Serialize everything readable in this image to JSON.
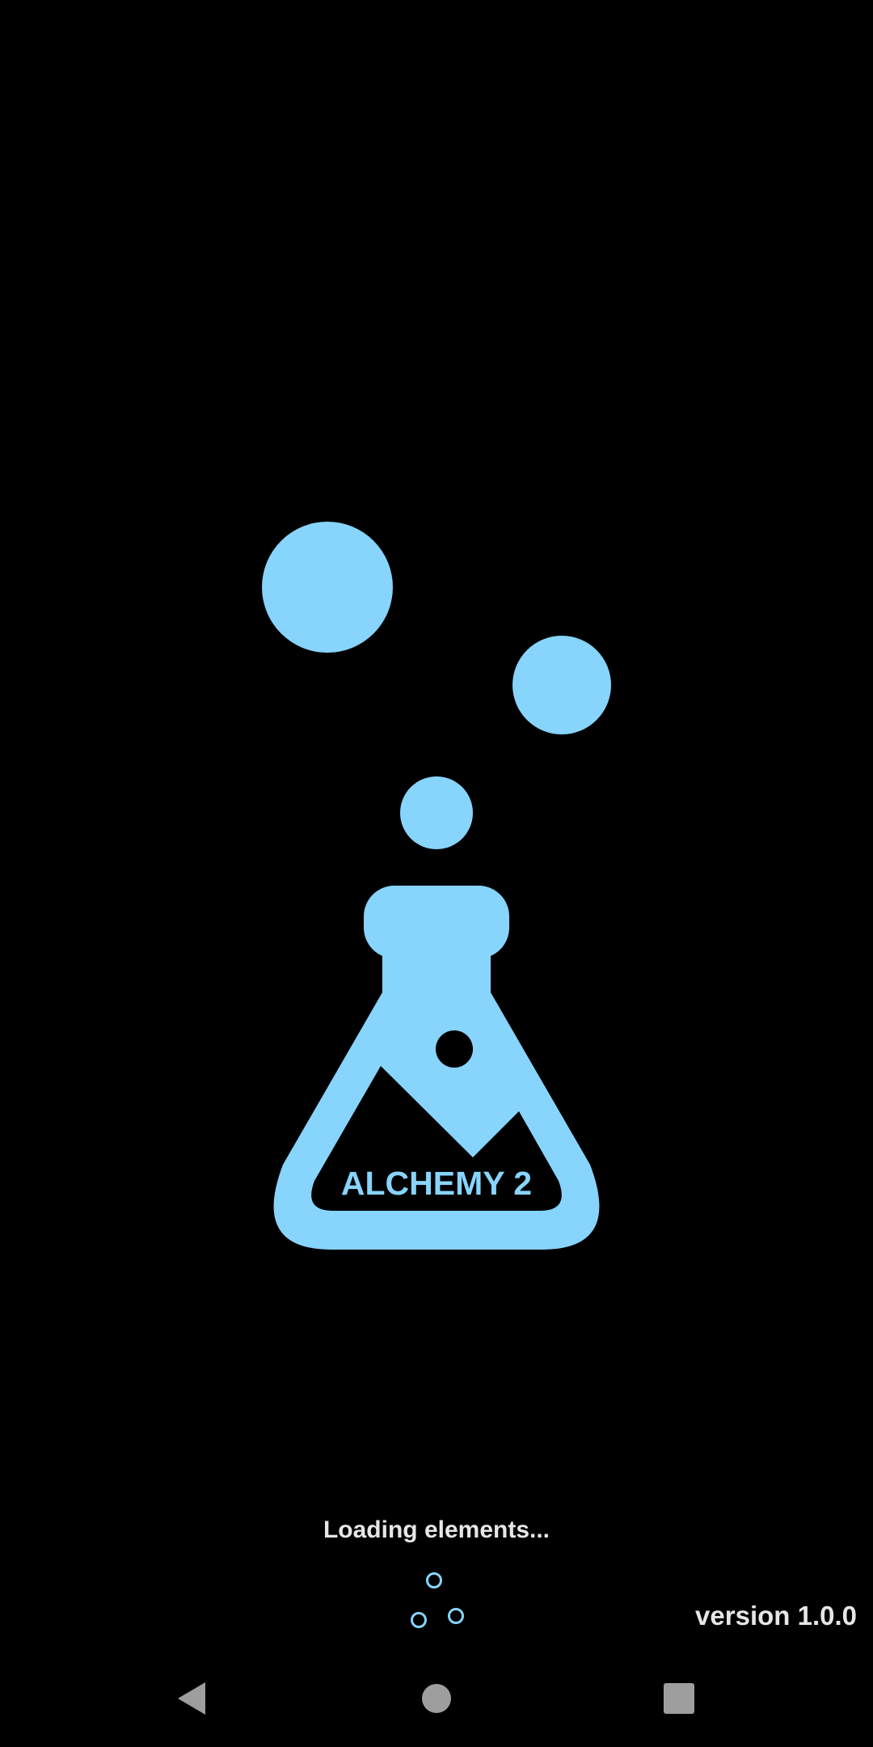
{
  "splash": {
    "logo_text": "ALCHEMY 2",
    "loading_label": "Loading elements...",
    "version_label": "version 1.0.0"
  },
  "colors": {
    "background": "#000000",
    "accent": "#87d4fd",
    "text": "#e6e6e6",
    "nav_icon": "#9e9e9e"
  },
  "icons": {
    "logo": "flask-icon",
    "spinner": "loading-bubbles-icon",
    "nav_back": "back-triangle-icon",
    "nav_home": "home-circle-icon",
    "nav_recents": "recents-square-icon"
  }
}
